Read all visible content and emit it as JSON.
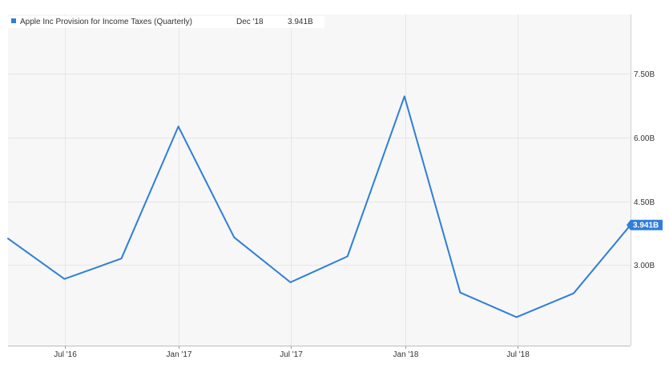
{
  "legend": {
    "series_name": "Apple Inc Provision for Income Taxes (Quarterly)",
    "latest_date": "Dec '18",
    "latest_value": "3.941B"
  },
  "colors": {
    "plot_background": "#f7f7f7",
    "grid": "#e6e6e6",
    "series": "#2f7ed8",
    "legend_marker": "#2f7ed8",
    "axis_text": "#333333",
    "badge_text": "#ffffff"
  },
  "chart_data": {
    "type": "line",
    "series": [
      {
        "name": "Apple Inc Provision for Income Taxes (Quarterly)",
        "x": [
          "2016-03-31",
          "2016-06-30",
          "2016-09-30",
          "2016-12-31",
          "2017-03-31",
          "2017-06-30",
          "2017-09-30",
          "2017-12-31",
          "2018-03-31",
          "2018-06-30",
          "2018-09-30",
          "2018-12-31"
        ],
        "values": [
          3.62,
          2.67,
          3.15,
          6.26,
          3.65,
          2.59,
          3.2,
          6.97,
          2.35,
          1.77,
          2.33,
          3.941
        ]
      }
    ],
    "x_ticks": [
      {
        "date": "2016-07-01",
        "label": "Jul '16"
      },
      {
        "date": "2017-01-01",
        "label": "Jan '17"
      },
      {
        "date": "2017-07-01",
        "label": "Jul '17"
      },
      {
        "date": "2018-01-01",
        "label": "Jan '18"
      },
      {
        "date": "2018-07-01",
        "label": "Jul '18"
      }
    ],
    "y_ticks": [
      {
        "value": 3.0,
        "label": "3.00B"
      },
      {
        "value": 4.5,
        "label": "4.50B"
      },
      {
        "value": 6.0,
        "label": "6.00B"
      },
      {
        "value": 7.5,
        "label": "7.50B"
      }
    ],
    "last_value_label": "3.941B",
    "ylim": [
      1.1,
      8.9
    ],
    "xlim": [
      "2016-03-31",
      "2018-12-31"
    ],
    "y_axis_position": "right",
    "grid": true,
    "legend_position": "top-left"
  }
}
